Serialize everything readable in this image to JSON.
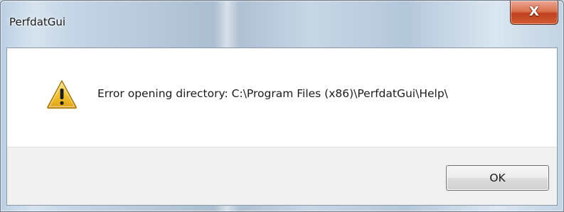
{
  "window": {
    "title": "PerfdatGui",
    "close_glyph": "X"
  },
  "dialog": {
    "icon": "warning-icon",
    "message": "Error opening directory: C:\\Program Files (x86)\\PerfdatGui\\Help\\",
    "ok_label": "OK"
  },
  "colors": {
    "close_button": "#c7502c",
    "warning_fill": "#f2c12e",
    "button_area": "#f0f0f0"
  }
}
